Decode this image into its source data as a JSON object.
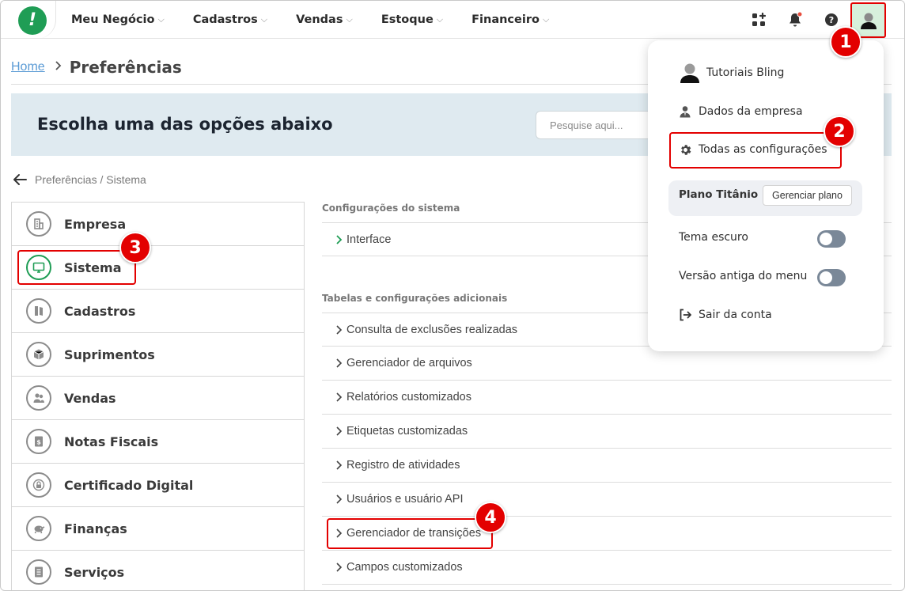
{
  "nav": {
    "logo_text": "!",
    "menu": [
      "Meu Negócio",
      "Cadastros",
      "Vendas",
      "Estoque",
      "Financeiro"
    ],
    "chevron": "⌵",
    "icons": [
      "apps-icon",
      "bell-icon",
      "help-icon",
      "user-avatar-icon"
    ],
    "notification_dot_color": "#e74c3c"
  },
  "breadcrumb": {
    "home": "Home",
    "separator": "›",
    "current": "Preferências"
  },
  "banner": {
    "title": "Escolha uma das opções abaixo",
    "search_placeholder": "Pesquise aqui..."
  },
  "back": {
    "text": "Preferências / Sistema"
  },
  "categories": [
    {
      "label": "Empresa",
      "icon": "building-icon"
    },
    {
      "label": "Sistema",
      "icon": "monitor-icon",
      "active": true
    },
    {
      "label": "Cadastros",
      "icon": "book-icon"
    },
    {
      "label": "Suprimentos",
      "icon": "box-icon"
    },
    {
      "label": "Vendas",
      "icon": "users-icon"
    },
    {
      "label": "Notas Fiscais",
      "icon": "invoice-icon"
    },
    {
      "label": "Certificado Digital",
      "icon": "lock-icon"
    },
    {
      "label": "Finanças",
      "icon": "piggy-bank-icon"
    },
    {
      "label": "Serviços",
      "icon": "document-icon"
    }
  ],
  "system_section": {
    "title": "Configurações do sistema",
    "items": [
      "Interface"
    ]
  },
  "tables_section": {
    "title": "Tabelas e configurações adicionais",
    "items": [
      "Consulta de exclusões realizadas",
      "Gerenciador de arquivos",
      "Relatórios customizados",
      "Etiquetas customizadas",
      "Registro de atividades",
      "Usuários e usuário API",
      "Gerenciador de transições",
      "Campos customizados"
    ]
  },
  "dropdown": {
    "user_name": "Tutoriais Bling",
    "company": "Dados da empresa",
    "all_settings": "Todas as configurações",
    "plan_name": "Plano Titânio",
    "manage_plan": "Gerenciar plano",
    "dark_theme": "Tema escuro",
    "old_menu": "Versão antiga do menu",
    "logout": "Sair da conta"
  },
  "badges": [
    "1",
    "2",
    "3",
    "4"
  ],
  "colors": {
    "brand_green": "#1f9d55",
    "annotation_red": "#e30000",
    "banner_bg": "#dfeaf0",
    "link_blue": "#5b9bd5",
    "toggle_off": "#7a8898"
  }
}
